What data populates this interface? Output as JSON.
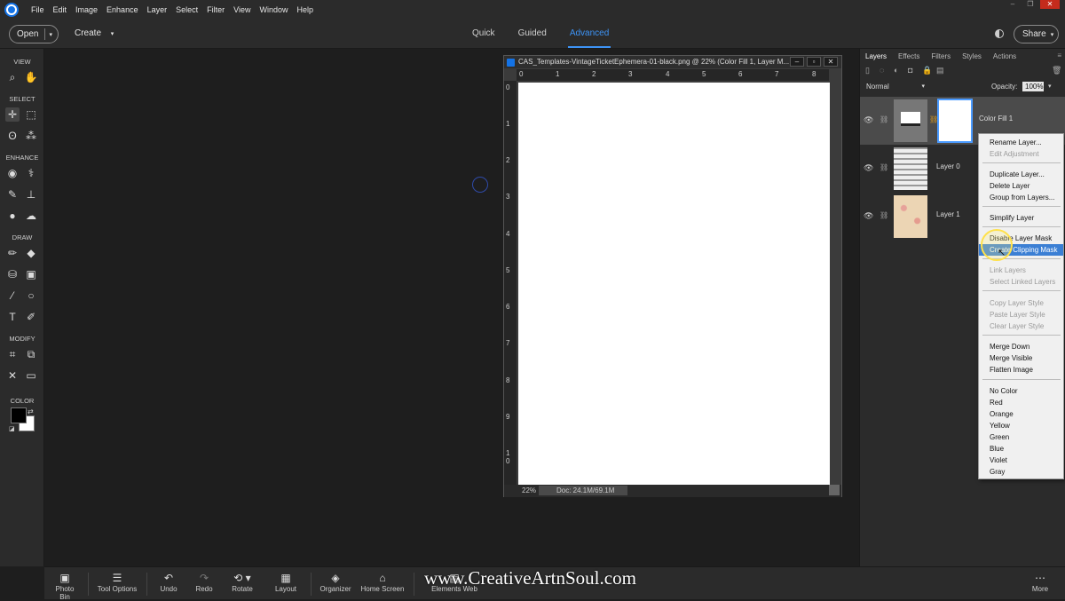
{
  "menubar": {
    "items": [
      "File",
      "Edit",
      "Image",
      "Enhance",
      "Layer",
      "Select",
      "Filter",
      "View",
      "Window",
      "Help"
    ],
    "window_controls": {
      "minimize": "–",
      "restore": "❐",
      "close": "✕"
    }
  },
  "optionsbar": {
    "open_label": "Open",
    "create_label": "Create",
    "modes": [
      "Quick",
      "Guided",
      "Advanced"
    ],
    "active_mode": "Advanced",
    "share_label": "Share"
  },
  "toolbar": {
    "sections": {
      "view": "VIEW",
      "select": "SELECT",
      "enhance": "ENHANCE",
      "draw": "DRAW",
      "modify": "MODIFY",
      "color": "COLOR"
    },
    "foreground_color": "#000000",
    "background_color": "#ffffff"
  },
  "document": {
    "title": "CAS_Templates-VintageTicketEphemera-01-black.png @ 22% (Color Fill 1, Layer M...",
    "ruler_top": [
      "0",
      "1",
      "2",
      "3",
      "4",
      "5",
      "6",
      "7",
      "8"
    ],
    "ruler_left": [
      "0",
      "1",
      "2",
      "3",
      "4",
      "5",
      "6",
      "7",
      "8",
      "9",
      "1\n0"
    ],
    "zoom": "22%",
    "doc_size": "Doc: 24.1M/69.1M"
  },
  "layers_panel": {
    "tabs": [
      "Layers",
      "Effects",
      "Filters",
      "Styles",
      "Actions"
    ],
    "active_tab": "Layers",
    "blend_mode": "Normal",
    "opacity_label": "Opacity:",
    "opacity_value": "100%",
    "layers": [
      {
        "name": "Color Fill 1",
        "selected": true
      },
      {
        "name": "Layer 0",
        "selected": false
      },
      {
        "name": "Layer 1",
        "selected": false
      }
    ]
  },
  "context_menu": {
    "items": [
      {
        "label": "Rename Layer...",
        "disabled": false
      },
      {
        "label": "Edit Adjustment",
        "disabled": true
      },
      {
        "label": "Duplicate Layer...",
        "disabled": false
      },
      {
        "label": "Delete Layer",
        "disabled": false
      },
      {
        "label": "Group from Layers...",
        "disabled": false
      },
      {
        "label": "Simplify Layer",
        "disabled": false
      },
      {
        "label": "Disable Layer Mask",
        "disabled": false
      },
      {
        "label": "Create Clipping Mask",
        "disabled": false,
        "highlighted": true
      },
      {
        "label": "Link Layers",
        "disabled": true
      },
      {
        "label": "Select Linked Layers",
        "disabled": true
      },
      {
        "label": "Copy Layer Style",
        "disabled": true
      },
      {
        "label": "Paste Layer Style",
        "disabled": true
      },
      {
        "label": "Clear Layer Style",
        "disabled": true
      },
      {
        "label": "Merge Down",
        "disabled": false
      },
      {
        "label": "Merge Visible",
        "disabled": false
      },
      {
        "label": "Flatten Image",
        "disabled": false
      },
      {
        "label": "No Color",
        "disabled": false
      },
      {
        "label": "Red",
        "disabled": false
      },
      {
        "label": "Orange",
        "disabled": false
      },
      {
        "label": "Yellow",
        "disabled": false
      },
      {
        "label": "Green",
        "disabled": false
      },
      {
        "label": "Blue",
        "disabled": false
      },
      {
        "label": "Violet",
        "disabled": false
      },
      {
        "label": "Gray",
        "disabled": false
      }
    ]
  },
  "bottombar": {
    "items": [
      "Photo Bin",
      "Tool Options",
      "Undo",
      "Redo",
      "Rotate",
      "Layout",
      "Organizer",
      "Home Screen",
      "Elements Web",
      "More"
    ],
    "watermark": "www.CreativeArtnSoul.com"
  },
  "colors": {
    "accent": "#3d93f5",
    "highlight": "#3b7fd4",
    "panel_bg": "#2b2b2b",
    "workspace_bg": "#1e1e1e"
  }
}
